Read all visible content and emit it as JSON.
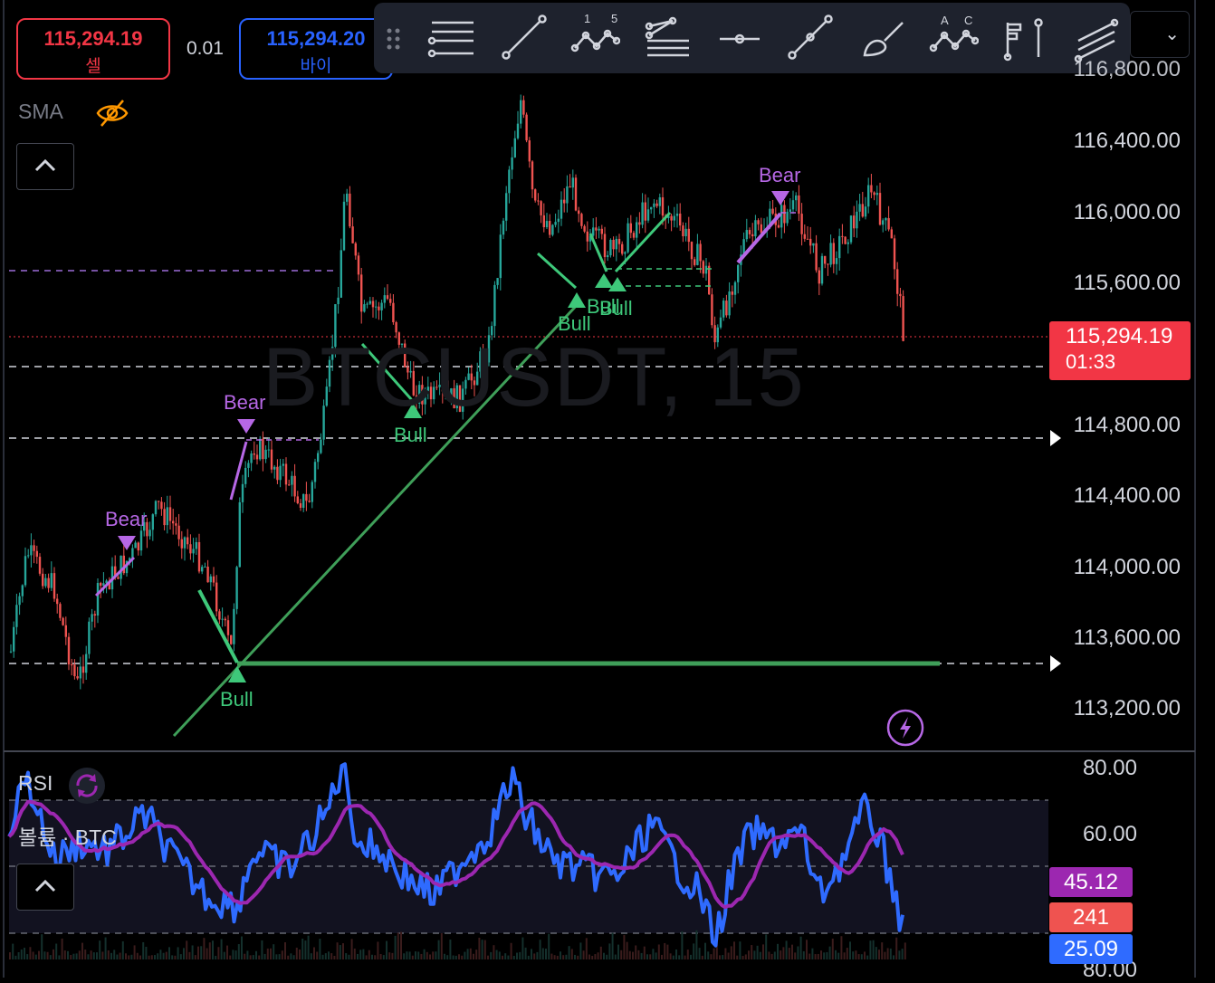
{
  "trade": {
    "sell_price": "115,294.19",
    "sell_label": "셀",
    "buy_price": "115,294.20",
    "buy_label": "바이",
    "quantity": "0.01"
  },
  "toolbar": {
    "icons": [
      "lines-icon",
      "trendline-icon",
      "xabcd-pattern-icon",
      "pitchfork-icon",
      "horizontal-ray-icon",
      "segment-icon",
      "brush-icon",
      "abcd-pattern-icon",
      "marker-icon",
      "parallel-channel-icon"
    ],
    "pattern_labels": {
      "one": "1",
      "five": "5",
      "a": "A",
      "c": "C"
    }
  },
  "indicator": {
    "sma_label": "SMA",
    "rsi_label": "RSI",
    "volume_label": "볼륨 · BTC"
  },
  "symbol_watermark": "BTCUSDT, 15",
  "price_axis": {
    "partial_top": "116,800.00",
    "ticks": [
      "116,400.00",
      "116,000.00",
      "115,600.00",
      "114,800.00",
      "114,400.00",
      "114,000.00",
      "113,600.00",
      "113,200.00"
    ]
  },
  "last_price": {
    "value": "115,294.19",
    "countdown": "01:33",
    "color": "#f23645"
  },
  "signals": {
    "bear": "Bear",
    "bull": "Bull"
  },
  "rsi_axis": {
    "ticks": [
      "80.00",
      "60.00"
    ],
    "bottom_partial": "80.00"
  },
  "badges": {
    "rsi_sma": "45.12",
    "volume": "241",
    "rsi": "25.09"
  },
  "colors": {
    "bull": "#3ec87a",
    "bear": "#b667e5",
    "up_candle": "#26a69a",
    "down_candle": "#ef5350",
    "rsi_line": "#2f6bff",
    "rsi_ma": "#9c27b0"
  }
}
